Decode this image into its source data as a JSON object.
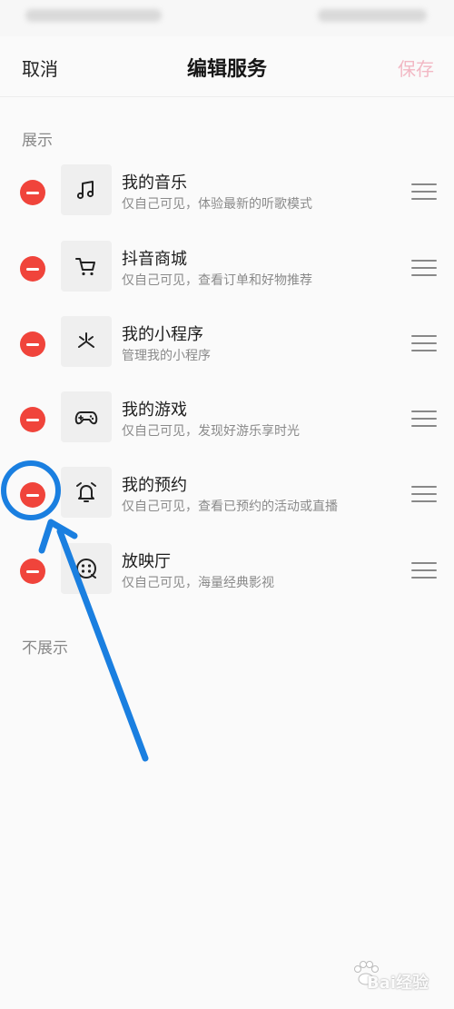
{
  "status_bar": {},
  "header": {
    "cancel_label": "取消",
    "title": "编辑服务",
    "save_label": "保存"
  },
  "sections": {
    "shown_label": "展示",
    "hidden_label": "不展示"
  },
  "services": [
    {
      "title": "我的音乐",
      "subtitle": "仅自己可见，体验最新的听歌模式",
      "icon": "music-note-icon"
    },
    {
      "title": "抖音商城",
      "subtitle": "仅自己可见，查看订单和好物推荐",
      "icon": "shopping-cart-icon"
    },
    {
      "title": "我的小程序",
      "subtitle": "管理我的小程序",
      "icon": "mini-program-icon"
    },
    {
      "title": "我的游戏",
      "subtitle": "仅自己可见，发现好游乐享时光",
      "icon": "gamepad-icon"
    },
    {
      "title": "我的预约",
      "subtitle": "仅自己可见，查看已预约的活动或直播",
      "icon": "alarm-bell-icon"
    },
    {
      "title": "放映厅",
      "subtitle": "仅自己可见，海量经典影视",
      "icon": "film-reel-icon"
    }
  ],
  "colors": {
    "remove": "#f0443b",
    "save_disabled": "#f2b8c4",
    "annotation": "#1a7fe0"
  },
  "watermark": {
    "text": "Bai经验"
  }
}
